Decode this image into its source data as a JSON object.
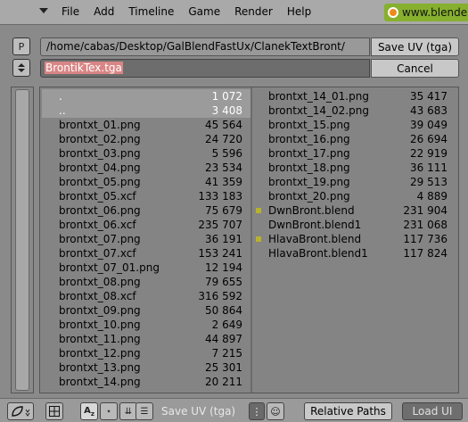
{
  "menubar": {
    "items": [
      "File",
      "Add",
      "Timeline",
      "Game",
      "Render",
      "Help"
    ],
    "url_text": "www.blende"
  },
  "path_row": {
    "parent_button": "P",
    "path": "/home/cabas/Desktop/GalBlendFastUx/ClanekTextBront/",
    "save_button": "Save UV (tga)"
  },
  "file_row": {
    "filename": "BrontikTex.tga",
    "cancel_button": "Cancel"
  },
  "files_left": [
    {
      "name": ".",
      "size": "1 072",
      "dir": true
    },
    {
      "name": "..",
      "size": "3 408",
      "dir": true
    },
    {
      "name": "brontxt_01.png",
      "size": "45 564"
    },
    {
      "name": "brontxt_02.png",
      "size": "24 720"
    },
    {
      "name": "brontxt_03.png",
      "size": "5 596"
    },
    {
      "name": "brontxt_04.png",
      "size": "23 534"
    },
    {
      "name": "brontxt_05.png",
      "size": "41 359"
    },
    {
      "name": "brontxt_05.xcf",
      "size": "133 183"
    },
    {
      "name": "brontxt_06.png",
      "size": "75 679"
    },
    {
      "name": "brontxt_06.xcf",
      "size": "235 707"
    },
    {
      "name": "brontxt_07.png",
      "size": "36 191"
    },
    {
      "name": "brontxt_07.xcf",
      "size": "153 241"
    },
    {
      "name": "brontxt_07_01.png",
      "size": "12 194"
    },
    {
      "name": "brontxt_08.png",
      "size": "79 655"
    },
    {
      "name": "brontxt_08.xcf",
      "size": "316 592"
    },
    {
      "name": "brontxt_09.png",
      "size": "50 864"
    },
    {
      "name": "brontxt_10.png",
      "size": "2 649"
    },
    {
      "name": "brontxt_11.png",
      "size": "44 897"
    },
    {
      "name": "brontxt_12.png",
      "size": "7 215"
    },
    {
      "name": "brontxt_13.png",
      "size": "25 301"
    },
    {
      "name": "brontxt_14.png",
      "size": "20 211"
    }
  ],
  "files_right": [
    {
      "name": "brontxt_14_01.png",
      "size": "35 417"
    },
    {
      "name": "brontxt_14_02.png",
      "size": "43 683"
    },
    {
      "name": "brontxt_15.png",
      "size": "39 049"
    },
    {
      "name": "brontxt_16.png",
      "size": "26 694"
    },
    {
      "name": "brontxt_17.png",
      "size": "22 919"
    },
    {
      "name": "brontxt_18.png",
      "size": "36 111"
    },
    {
      "name": "brontxt_19.png",
      "size": "29 513"
    },
    {
      "name": "brontxt_20.png",
      "size": "4 889"
    },
    {
      "name": "DwnBront.blend",
      "size": "231 904",
      "blend": true
    },
    {
      "name": "DwnBront.blend1",
      "size": "231 068"
    },
    {
      "name": "HlavaBront.blend",
      "size": "117 736",
      "blend": true
    },
    {
      "name": "HlavaBront.blend1",
      "size": "117 824"
    }
  ],
  "bottombar": {
    "mode_label": "Save UV (tga)",
    "relative_paths_button": "Relative Paths",
    "load_ui_button": "Load UI"
  },
  "colors": {
    "background": "#8a8a8a",
    "url_badge": "#86b02e",
    "filename_highlight": "#d98585",
    "blend_marker": "#b7b22b"
  },
  "icons": [
    "menu-arrow-icon",
    "blender-logo-icon",
    "parent-dir-icon",
    "up-down-arrows-icon",
    "leaf-icon",
    "grid-view-icon",
    "sort-alpha-icon",
    "sort-time-icon",
    "sort-size-icon",
    "filter-icon",
    "hidden-files-icon",
    "ghost-icon"
  ]
}
